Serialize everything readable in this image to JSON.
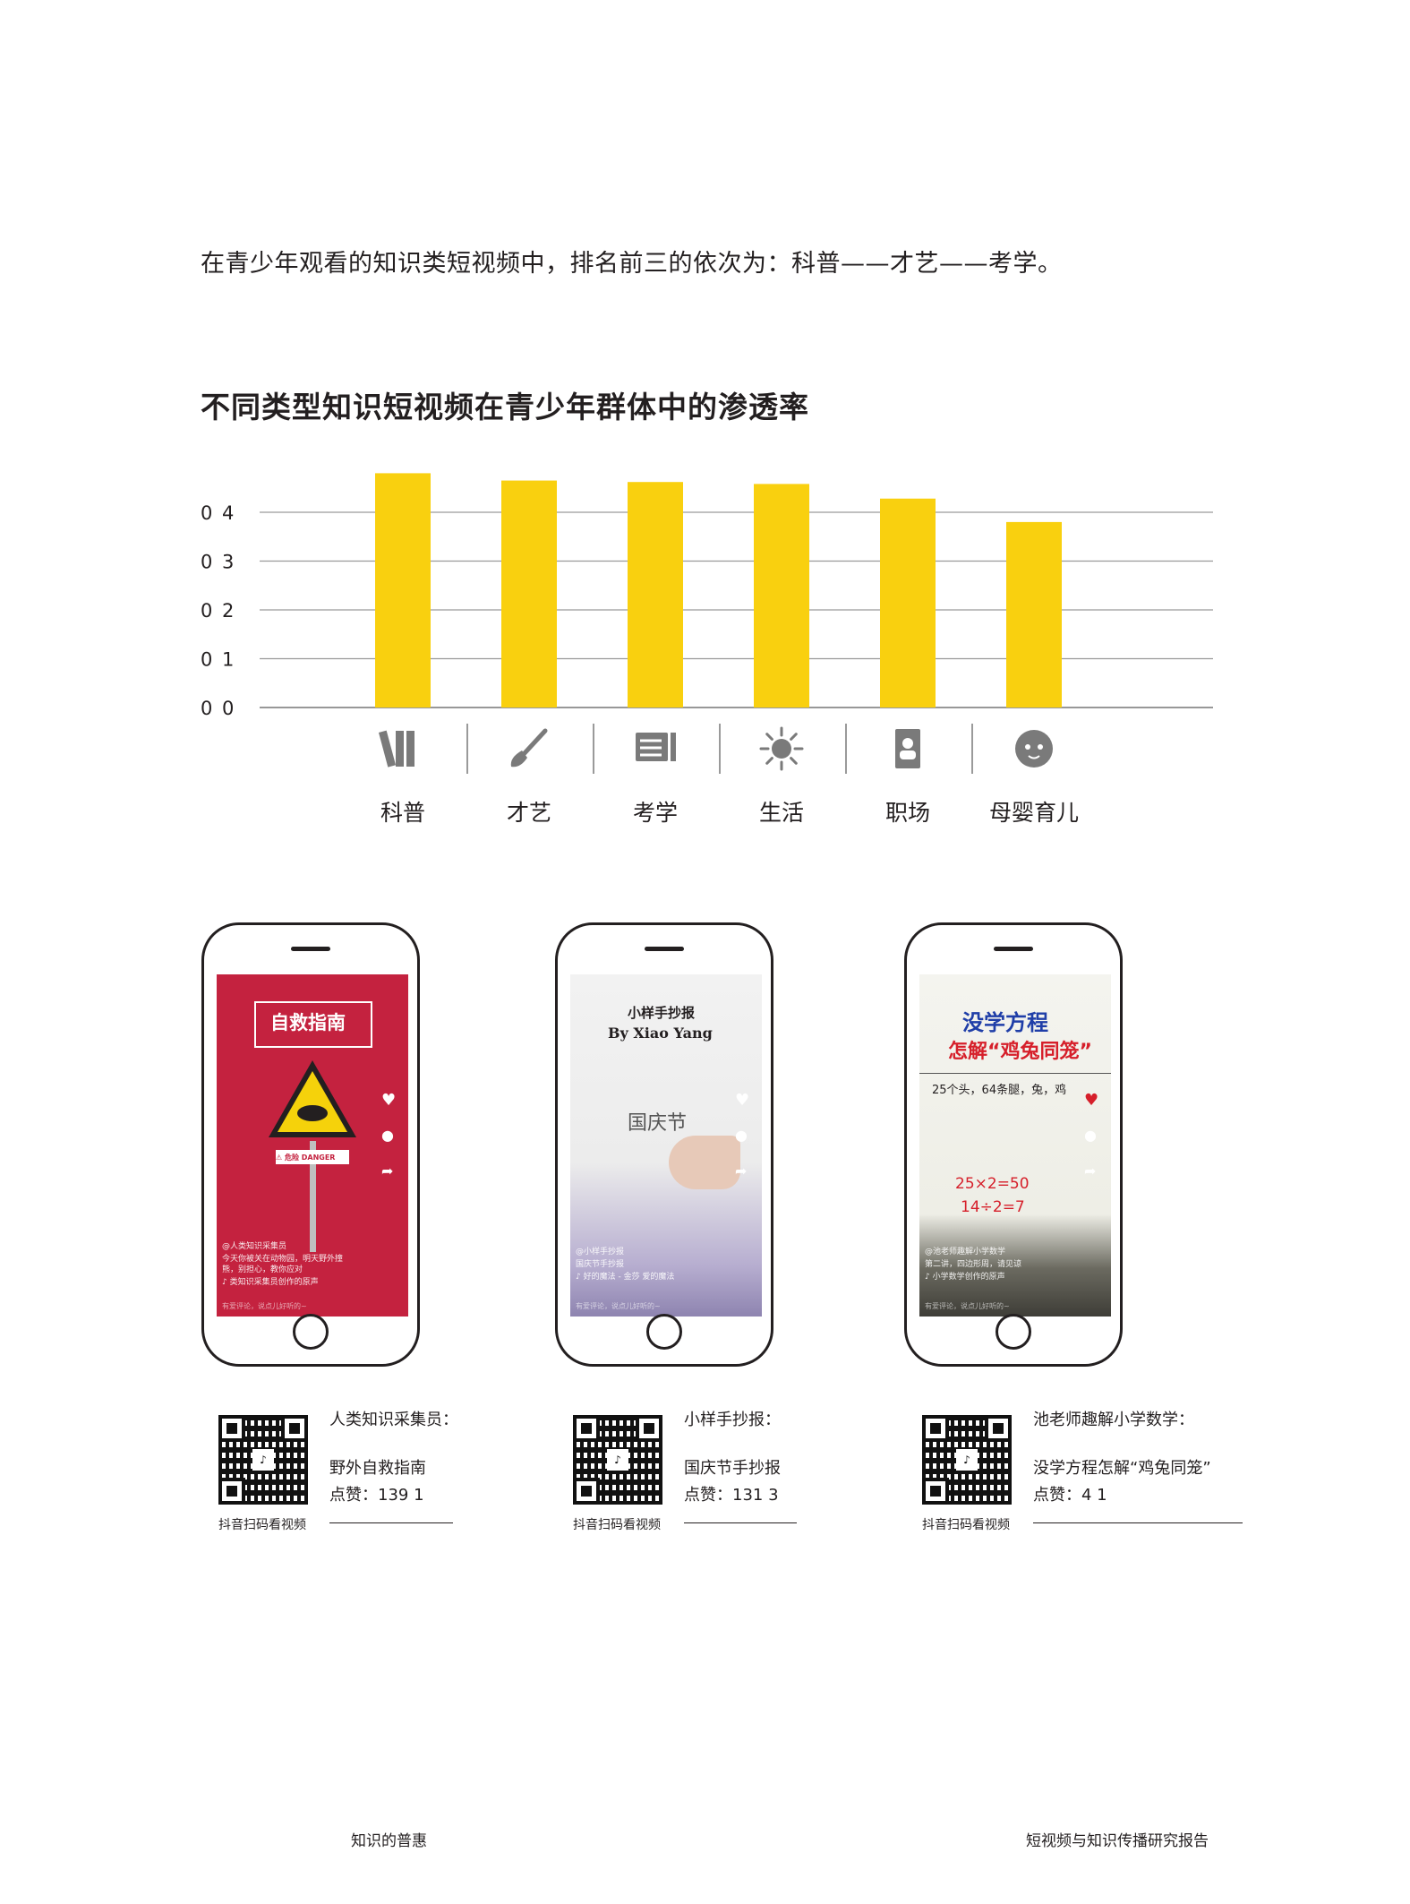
{
  "intro": "在青少年观看的知识类短视频中，排名前三的依次为：科普——才艺——考学。",
  "chart_title": "不同类型知识短视频在青少年群体中的渗透率",
  "chart_data": {
    "type": "bar",
    "categories": [
      "科普",
      "才艺",
      "考学",
      "生活",
      "职场",
      "母婴育儿"
    ],
    "values": [
      0.48,
      0.465,
      0.462,
      0.458,
      0.428,
      0.38
    ],
    "yticks": [
      "0 0",
      "0 1",
      "0 2",
      "0 3",
      "0 4"
    ],
    "ylim": [
      0,
      0.4
    ],
    "grid": true,
    "color": "#f9d00f",
    "icons": [
      "books-icon",
      "brush-icon",
      "exam-icon",
      "sun-icon",
      "id-badge-icon",
      "baby-icon"
    ]
  },
  "phones": [
    {
      "bg": "#c4223f",
      "big_title": "自救指南",
      "sign_text": "⚠ 危险 DANGER",
      "caption1": "@人类知识采集员",
      "caption2": "今天你被关在动物园，明天野外撞熊，别担心，教你应对",
      "caption3": "♪ 类知识采集员创作的原声"
    },
    {
      "bg": "#e9e9ee",
      "big_title": "小样手抄报",
      "sub_title": "By Xiao Yang",
      "handwriting": "国庆节",
      "caption1": "@小样手抄报",
      "caption2": "国庆节手抄报",
      "caption3": "♪ 好的魔法 - 金莎 爱的魔法"
    },
    {
      "bg": "#f4f4ef",
      "big_title": "没学方程",
      "sub_title": "怎解“鸡兔同笼”",
      "line1": "25个头，64条腿，兔，鸡",
      "line2": "25×2=50",
      "line3": "14÷2=7",
      "caption1": "@池老师趣解小学数学",
      "caption2": "第二讲，四边形周，请见谅",
      "caption3": "♪ 小学数学创作的原声"
    }
  ],
  "cards": [
    {
      "scan": "抖音扫码看视频",
      "author": "人类知识采集员：",
      "title": "野外自救指南",
      "likes": "点赞：139 1"
    },
    {
      "scan": "抖音扫码看视频",
      "author": "小样手抄报：",
      "title": "国庆节手抄报",
      "likes": "点赞：131 3"
    },
    {
      "scan": "抖音扫码看视频",
      "author": "池老师趣解小学数学：",
      "title": "没学方程怎解“鸡兔同笼”",
      "likes": "点赞：4 1"
    }
  ],
  "footer_left": "知识的普惠",
  "footer_right": "短视频与知识传播研究报告",
  "comment_placeholder": "有爱评论，说点儿好听的~"
}
